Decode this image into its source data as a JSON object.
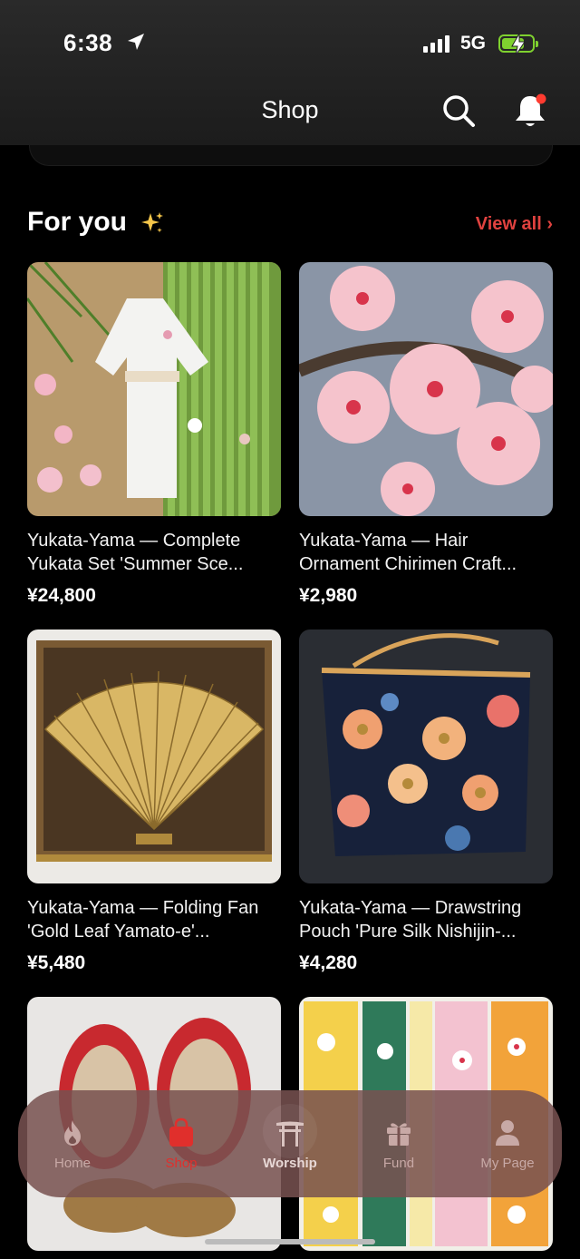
{
  "status": {
    "time": "6:38",
    "network": "5G"
  },
  "header": {
    "title": "Shop"
  },
  "section": {
    "title": "For you",
    "view_all": "View all"
  },
  "products": [
    {
      "name": "Yukata-Yama — Complete Yukata Set 'Summer Sce...",
      "price": "¥24,800"
    },
    {
      "name": "Yukata-Yama — Hair Ornament Chirimen Craft...",
      "price": "¥2,980"
    },
    {
      "name": "Yukata-Yama — Folding Fan 'Gold Leaf Yamato-e'...",
      "price": "¥5,480"
    },
    {
      "name": "Yukata-Yama — Drawstring Pouch 'Pure Silk Nishijin-...",
      "price": "¥4,280"
    }
  ],
  "tabbar": {
    "items": [
      {
        "label": "Home",
        "icon": "flame-icon"
      },
      {
        "label": "Shop",
        "icon": "shopping-bag-icon"
      },
      {
        "label": "Worship",
        "icon": "torii-gate-icon"
      },
      {
        "label": "Fund",
        "icon": "gift-icon"
      },
      {
        "label": "My Page",
        "icon": "person-icon"
      }
    ],
    "active": "Shop"
  },
  "colors": {
    "accent": "#e0423f",
    "battery": "#7fd12f",
    "tabbar": "#785250"
  }
}
